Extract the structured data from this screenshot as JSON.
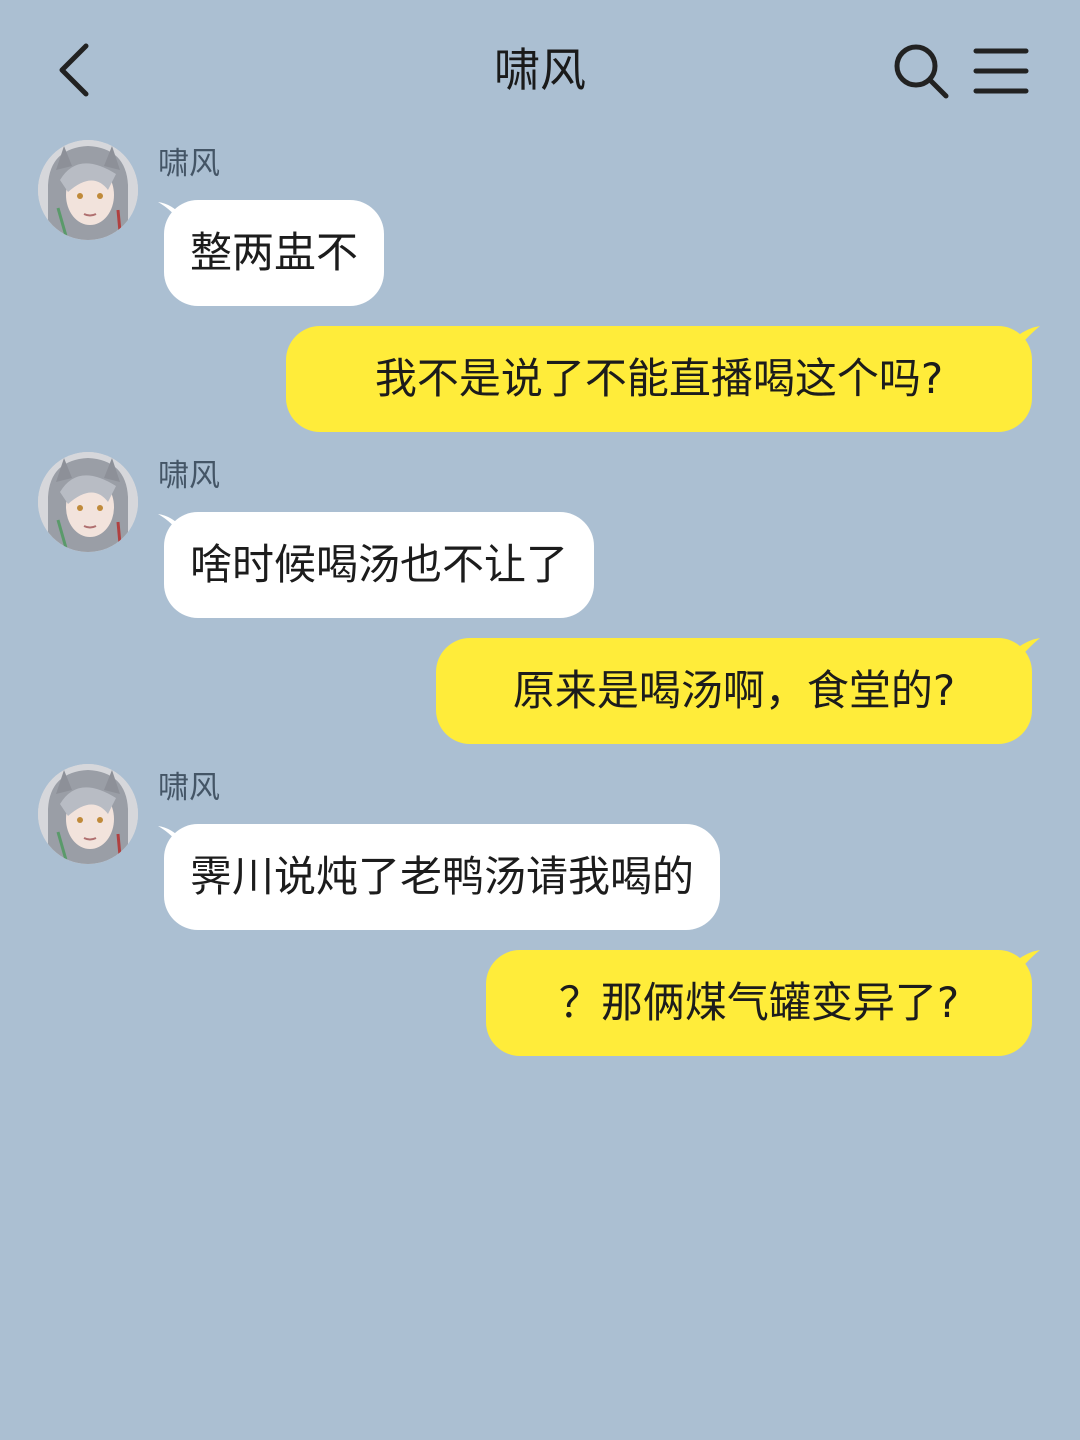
{
  "header": {
    "title": "啸风",
    "back_icon": "chevron-left-icon",
    "search_icon": "search-icon",
    "menu_icon": "menu-icon"
  },
  "messages": [
    {
      "side": "in",
      "sender": "啸风",
      "text": "整两盅不"
    },
    {
      "side": "out",
      "text": "我不是说了不能直播喝这个吗?"
    },
    {
      "side": "in",
      "sender": "啸风",
      "text": "啥时候喝汤也不让了"
    },
    {
      "side": "out",
      "text": "原来是喝汤啊，食堂的?"
    },
    {
      "side": "in",
      "sender": "啸风",
      "text": "霁川说炖了老鸭汤请我喝的"
    },
    {
      "side": "out",
      "text": "？那俩煤气罐变异了?"
    }
  ],
  "colors": {
    "background": "#abbfd2",
    "incoming_bubble": "#ffffff",
    "outgoing_bubble": "#ffec3a"
  }
}
